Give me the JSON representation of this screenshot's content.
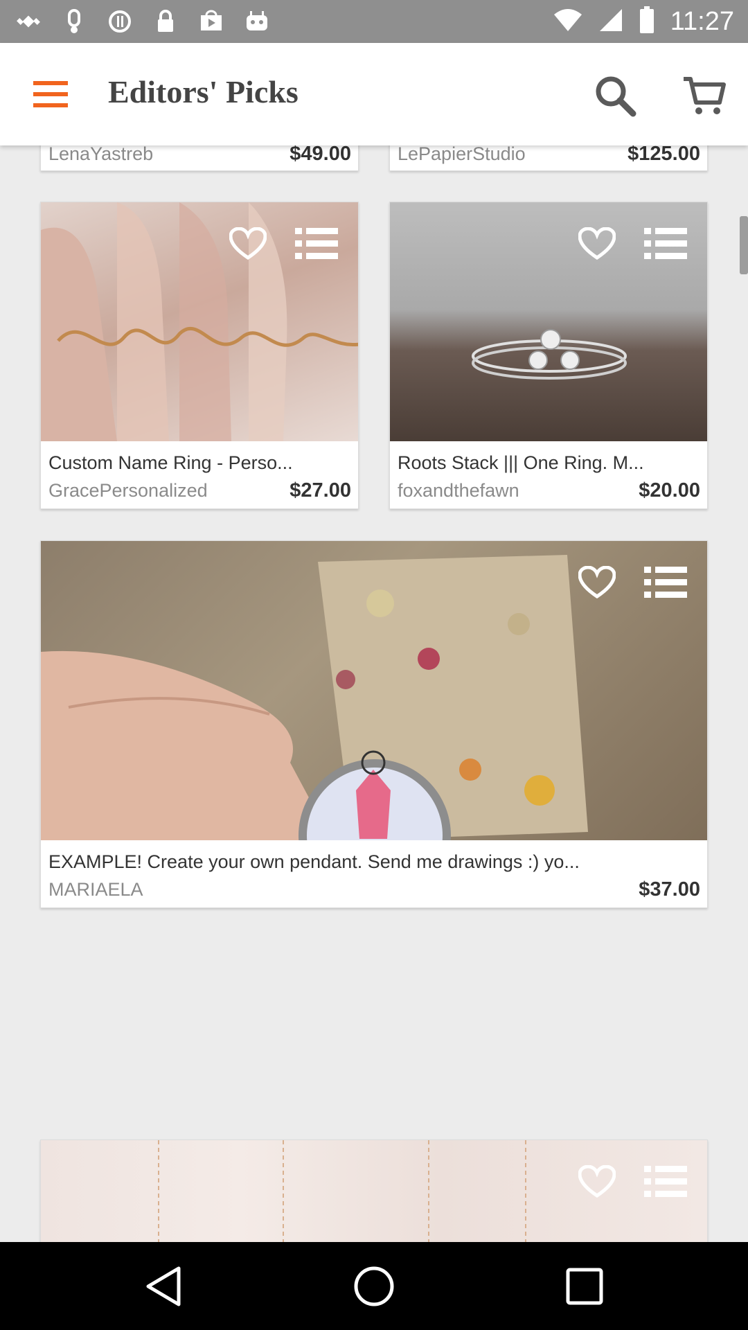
{
  "status_bar": {
    "time": "11:27",
    "icons": [
      "fake-gps-icon",
      "notification-icon",
      "info-icon",
      "lock-icon",
      "play-store-icon",
      "android-icon",
      "wifi-icon",
      "signal-icon",
      "battery-icon"
    ]
  },
  "app_bar": {
    "title": "Editors' Picks",
    "menu_icon": "hamburger-menu-icon",
    "search_icon": "search-icon",
    "cart_icon": "cart-icon"
  },
  "listings": [
    {
      "title": "",
      "shop": "LenaYastreb",
      "price": "$49.00"
    },
    {
      "title": "",
      "shop": "LePapierStudio",
      "price": "$125.00"
    },
    {
      "title": "Custom Name Ring - Perso...",
      "shop": "GracePersonalized",
      "price": "$27.00"
    },
    {
      "title": "Roots Stack ||| One Ring. M...",
      "shop": "foxandthefawn",
      "price": "$20.00"
    },
    {
      "title": "EXAMPLE! Create your own pendant. Send me drawings :) yo...",
      "shop": "MARIAELA",
      "price": "$37.00"
    },
    {
      "title": "",
      "shop": "",
      "price": ""
    }
  ],
  "colors": {
    "accent": "#f1641e",
    "status_bar": "#8f8f8f",
    "background": "#ececec",
    "nav_bar": "#000000"
  },
  "nav": {
    "back_icon": "back-triangle-icon",
    "home_icon": "home-circle-icon",
    "recents_icon": "recents-square-icon"
  }
}
